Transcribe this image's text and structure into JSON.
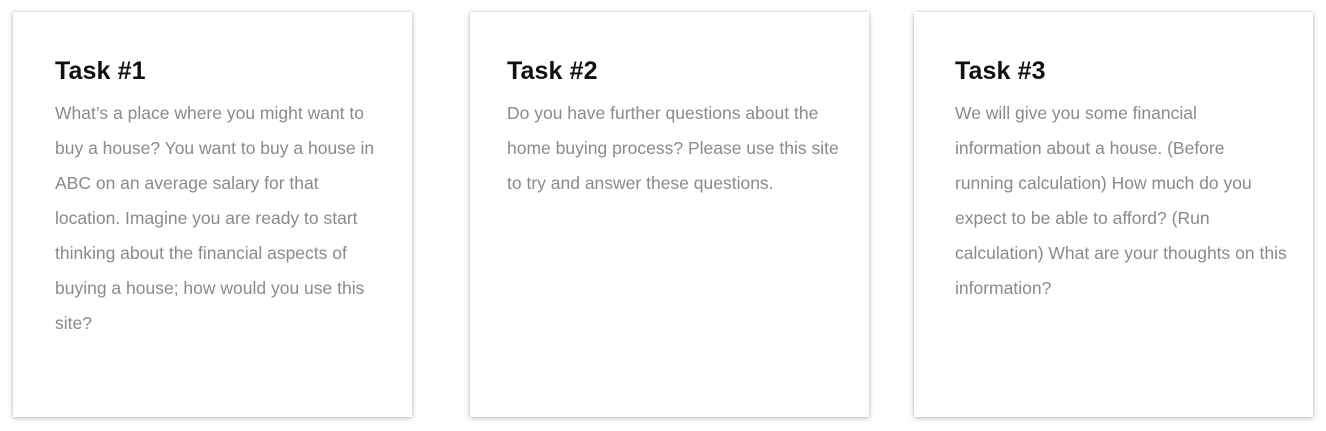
{
  "tasks": [
    {
      "title": "Task #1",
      "description": "What’s a place where you might want to buy a house? You want to buy a house in ABC on an average salary for that location. Imagine you are ready to start thinking about the financial aspects of buying a house; how would you use this site?"
    },
    {
      "title": "Task #2",
      "description": "Do you have further questions about the home buying process? Please use this site to try and answer these questions."
    },
    {
      "title": "Task #3",
      "description": "We will give you some financial information about a house. (Before running calculation) How much do you expect to be able to afford? (Run calculation) What are your thoughts on this information?"
    }
  ]
}
